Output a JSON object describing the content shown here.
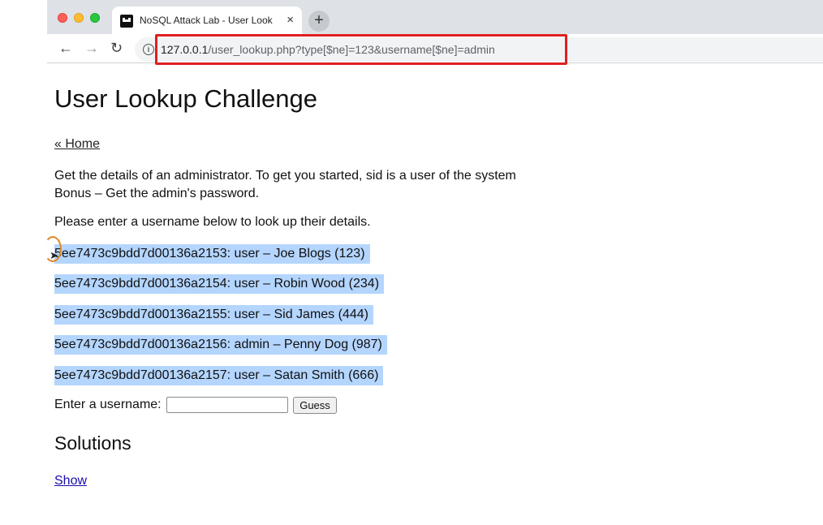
{
  "browser": {
    "tab_title": "NoSQL Attack Lab - User Look",
    "tab_close": "×",
    "new_tab": "+",
    "url_host": "127.0.0.1",
    "url_path": "/user_lookup.php?type[$ne]=123&username[$ne]=admin"
  },
  "page": {
    "title": "User Lookup Challenge",
    "home_link": "« Home",
    "description_line1": "Get the details of an administrator. To get you started, sid is a user of the system",
    "description_line2": "Bonus – Get the admin's password.",
    "prompt": "Please enter a username below to look up their details.",
    "users": [
      "5ee7473c9bdd7d00136a2153: user – Joe Blogs (123)",
      "5ee7473c9bdd7d00136a2154: user – Robin Wood (234)",
      "5ee7473c9bdd7d00136a2155: user – Sid James (444)",
      "5ee7473c9bdd7d00136a2156: admin – Penny Dog (987)",
      "5ee7473c9bdd7d00136a2157: user – Satan Smith (666)"
    ],
    "form_label": "Enter a username:",
    "username_value": "",
    "guess_label": "Guess",
    "solutions_heading": "Solutions",
    "show_link": "Show"
  },
  "colors": {
    "highlight_border": "#e02020",
    "selection": "#b4d5fe"
  }
}
